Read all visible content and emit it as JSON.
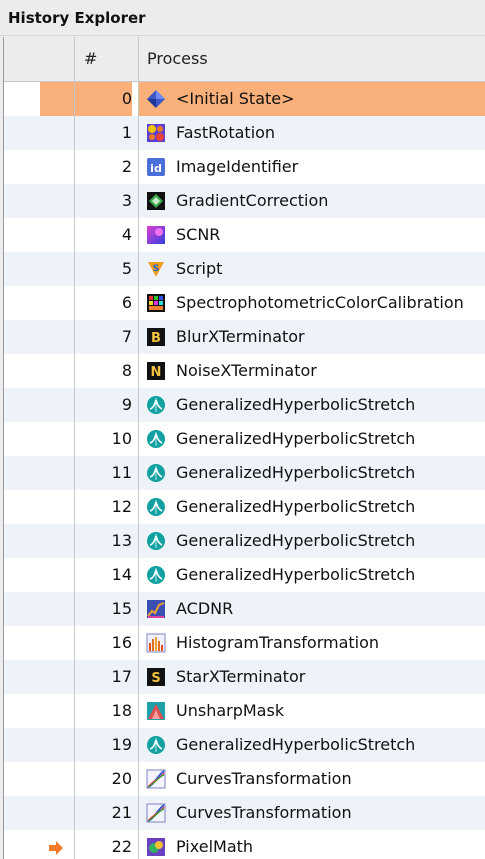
{
  "window": {
    "title": "History Explorer"
  },
  "table": {
    "headers": {
      "marker": "",
      "number": "#",
      "process": "Process"
    },
    "rows": [
      {
        "num": "0",
        "process": "<Initial State>",
        "icon": "initial-state-icon",
        "selected": true
      },
      {
        "num": "1",
        "process": "FastRotation",
        "icon": "fastrotation-icon"
      },
      {
        "num": "2",
        "process": "ImageIdentifier",
        "icon": "imageidentifier-icon"
      },
      {
        "num": "3",
        "process": "GradientCorrection",
        "icon": "gradientcorrection-icon"
      },
      {
        "num": "4",
        "process": "SCNR",
        "icon": "scnr-icon"
      },
      {
        "num": "5",
        "process": "Script",
        "icon": "script-icon"
      },
      {
        "num": "6",
        "process": "SpectrophotometricColorCalibration",
        "icon": "spcc-icon"
      },
      {
        "num": "7",
        "process": "BlurXTerminator",
        "icon": "blurxterminator-icon"
      },
      {
        "num": "8",
        "process": "NoiseXTerminator",
        "icon": "noisexterminator-icon"
      },
      {
        "num": "9",
        "process": "GeneralizedHyperbolicStretch",
        "icon": "ghs-icon"
      },
      {
        "num": "10",
        "process": "GeneralizedHyperbolicStretch",
        "icon": "ghs-icon"
      },
      {
        "num": "11",
        "process": "GeneralizedHyperbolicStretch",
        "icon": "ghs-icon"
      },
      {
        "num": "12",
        "process": "GeneralizedHyperbolicStretch",
        "icon": "ghs-icon"
      },
      {
        "num": "13",
        "process": "GeneralizedHyperbolicStretch",
        "icon": "ghs-icon"
      },
      {
        "num": "14",
        "process": "GeneralizedHyperbolicStretch",
        "icon": "ghs-icon"
      },
      {
        "num": "15",
        "process": "ACDNR",
        "icon": "acdnr-icon"
      },
      {
        "num": "16",
        "process": "HistogramTransformation",
        "icon": "histogramtransformation-icon"
      },
      {
        "num": "17",
        "process": "StarXTerminator",
        "icon": "starxterminator-icon"
      },
      {
        "num": "18",
        "process": "UnsharpMask",
        "icon": "unsharpmask-icon"
      },
      {
        "num": "19",
        "process": "GeneralizedHyperbolicStretch",
        "icon": "ghs-icon"
      },
      {
        "num": "20",
        "process": "CurvesTransformation",
        "icon": "curvestransformation-icon"
      },
      {
        "num": "21",
        "process": "CurvesTransformation",
        "icon": "curvestransformation-icon"
      },
      {
        "num": "22",
        "process": "PixelMath",
        "icon": "pixelmath-icon",
        "current": true
      }
    ]
  },
  "colors": {
    "selection": "#f9b07a",
    "row_alt": "#eef3fa",
    "current_marker": "#f07c2a"
  }
}
